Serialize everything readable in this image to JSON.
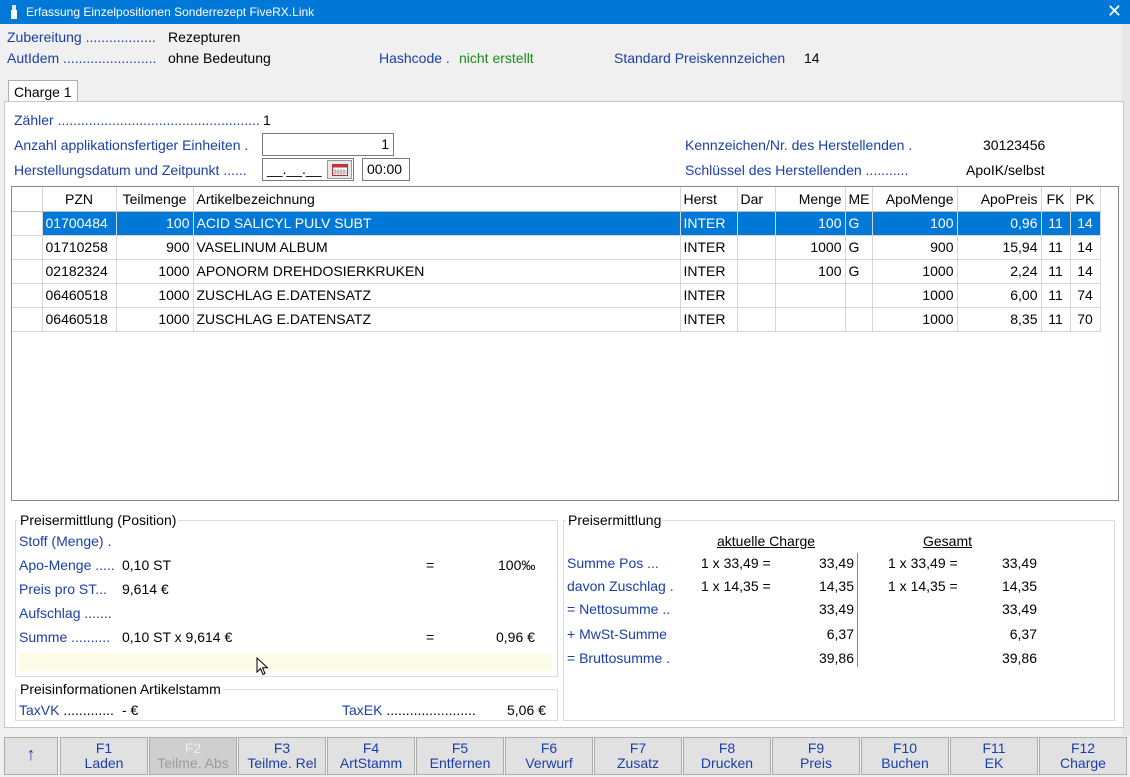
{
  "window": {
    "title": "Erfassung Einzelpositionen Sonderrezept FiveRX.Link",
    "close": "✕"
  },
  "header": {
    "zubereitung_label": "Zubereitung",
    "zubereitung_dots": " ..................",
    "zubereitung_value": "Rezepturen",
    "autidem_label": "AutIdem",
    "autidem_dots": " ........................",
    "autidem_value": "ohne Bedeutung",
    "hashcode_label": "Hashcode .",
    "hashcode_value": "nicht erstellt",
    "preiskz_label": "Standard Preiskennzeichen",
    "preiskz_value": "14"
  },
  "tab": {
    "label": "Charge 1"
  },
  "charge": {
    "zaehler_label": "Zähler ....................................................",
    "zaehler_value": "1",
    "anzahl_label": "Anzahl applikationsfertiger Einheiten .",
    "anzahl_value": "1",
    "datum_label": "Herstellungsdatum und Zeitpunkt ......",
    "datum_value": "__.__.__",
    "zeit_value": "00:00",
    "hersteller_label": "Kennzeichen/Nr. des Herstellenden .",
    "hersteller_value": "30123456",
    "schluessel_label": "Schlüssel des Herstellenden ...........",
    "schluessel_value": "ApoIK/selbst"
  },
  "grid": {
    "columns": [
      "",
      "PZN",
      "Teilmenge",
      "Artikelbezeichnung",
      "Herst",
      "Dar",
      "Menge",
      "ME",
      "ApoMenge",
      "ApoPreis",
      "FK",
      "PK"
    ],
    "rows": [
      [
        "",
        "01700484",
        "100",
        "ACID SALICYL PULV SUBT",
        "INTER",
        "",
        "100",
        "G",
        "100",
        "0,96",
        "11",
        "14"
      ],
      [
        "",
        "01710258",
        "900",
        "VASELINUM ALBUM",
        "INTER",
        "",
        "1000",
        "G",
        "900",
        "15,94",
        "11",
        "14"
      ],
      [
        "",
        "02182324",
        "1000",
        "APONORM DREHDOSIERKRUKEN",
        "INTER",
        "",
        "100",
        "G",
        "1000",
        "2,24",
        "11",
        "14"
      ],
      [
        "",
        "06460518",
        "1000",
        "ZUSCHLAG E.DATENSATZ",
        "INTER",
        "",
        "",
        "",
        "1000",
        "6,00",
        "11",
        "74"
      ],
      [
        "",
        "06460518",
        "1000",
        "ZUSCHLAG E.DATENSATZ",
        "INTER",
        "",
        "",
        "",
        "1000",
        "8,35",
        "11",
        "70"
      ]
    ],
    "selected_row": 0
  },
  "preis_position": {
    "title": "Preisermittlung (Position)",
    "stoff_label": "Stoff (Menge) .",
    "apo_menge_label": "Apo-Menge .....",
    "apo_menge_value": "0,10 ST",
    "apo_menge_eq": "=",
    "apo_menge_result": "100‰",
    "preis_st_label": "Preis pro ST...",
    "preis_st_value": "9,614 €",
    "aufschlag_label": "Aufschlag .......",
    "summe_label": "Summe ..........",
    "summe_value": "0,10 ST x 9,614 €",
    "summe_eq": "=",
    "summe_result": "0,96 €"
  },
  "preis_info": {
    "title": "Preisinformationen Artikelstamm",
    "taxvk_label": "TaxVK",
    "taxvk_dots": " .............",
    "taxvk_value": "- €",
    "taxek_label": "TaxEK",
    "taxek_dots": " .......................",
    "taxek_value": "5,06 €"
  },
  "preis_total": {
    "title": "Preisermittlung",
    "col_charge": "aktuelle Charge",
    "col_gesamt": "Gesamt",
    "rows": [
      {
        "label": "Summe Pos ...",
        "c_formula": "1 x 33,49 =",
        "c_value": "33,49",
        "g_formula": "1 x 33,49 =",
        "g_value": "33,49"
      },
      {
        "label": "davon Zuschlag .",
        "c_formula": "1 x 14,35 =",
        "c_value": "14,35",
        "g_formula": "1 x 14,35 =",
        "g_value": "14,35"
      },
      {
        "label": "= Nettosumme ..",
        "c_formula": "",
        "c_value": "33,49",
        "g_formula": "",
        "g_value": "33,49"
      },
      {
        "label": "+ MwSt-Summe",
        "c_formula": "",
        "c_value": "6,37",
        "g_formula": "",
        "g_value": "6,37"
      },
      {
        "label": "= Bruttosumme .",
        "c_formula": "",
        "c_value": "39,86",
        "g_formula": "",
        "g_value": "39,86"
      }
    ]
  },
  "fkeys": [
    {
      "key": "↑",
      "label": "",
      "enabled": true
    },
    {
      "key": "F1",
      "label": "Laden",
      "enabled": true
    },
    {
      "key": "F2",
      "label": "Teilme. Abs",
      "enabled": false
    },
    {
      "key": "F3",
      "label": "Teilme. Rel",
      "enabled": true
    },
    {
      "key": "F4",
      "label": "ArtStamm",
      "enabled": true
    },
    {
      "key": "F5",
      "label": "Entfernen",
      "enabled": true
    },
    {
      "key": "F6",
      "label": "Verwurf",
      "enabled": true
    },
    {
      "key": "F7",
      "label": "Zusatz",
      "enabled": true
    },
    {
      "key": "F8",
      "label": "Drucken",
      "enabled": true
    },
    {
      "key": "F9",
      "label": "Preis",
      "enabled": true
    },
    {
      "key": "F10",
      "label": "Buchen",
      "enabled": true
    },
    {
      "key": "F11",
      "label": "EK",
      "enabled": true
    },
    {
      "key": "F12",
      "label": "Charge",
      "enabled": true
    }
  ],
  "colors": {
    "titlebar": "#0078d7",
    "selection": "#0078d7",
    "label_blue": "#1a3fa8",
    "status_green": "#1d8a1d"
  }
}
